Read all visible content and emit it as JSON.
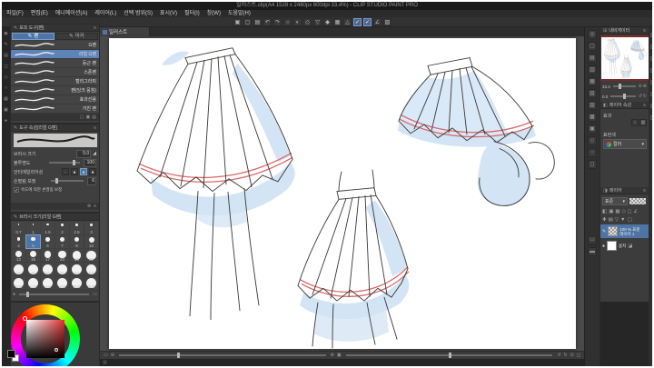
{
  "window": {
    "title": "일러스트.clip(A4 1528 x 2480px 600dpi 33.4%) - CLIP STUDIO PAINT PRO"
  },
  "menu": {
    "items": [
      "파일(F)",
      "편집(E)",
      "애니메이션(A)",
      "레이어(L)",
      "선택 범위(S)",
      "표시(V)",
      "필터(I)",
      "창(W)",
      "도움말(H)"
    ]
  },
  "toolbar": {
    "icons": [
      {
        "name": "save-icon",
        "glyph": "▣",
        "active": false
      },
      {
        "name": "open-icon",
        "glyph": "▢",
        "active": false
      },
      {
        "name": "export-icon",
        "glyph": "▤",
        "active": false
      },
      {
        "name": "undo-icon",
        "glyph": "↶",
        "active": false
      },
      {
        "name": "redo-icon",
        "glyph": "↷",
        "active": false
      },
      {
        "name": "deselect-icon",
        "glyph": "○",
        "active": false
      },
      {
        "name": "invert-selection-icon",
        "glyph": "◐",
        "active": false
      },
      {
        "name": "selection-border-icon",
        "glyph": "◇",
        "active": false
      },
      {
        "name": "clear-icon",
        "glyph": "▽",
        "active": false
      },
      {
        "name": "fill-icon",
        "glyph": "◆",
        "active": false
      },
      {
        "name": "grid-icon",
        "glyph": "▦",
        "active": false
      },
      {
        "name": "snap-ruler-icon",
        "glyph": "△",
        "active": false
      },
      {
        "name": "snap-line-icon",
        "glyph": "✓",
        "active": true
      },
      {
        "name": "snap-special-ruler-icon",
        "glyph": "✓",
        "active": true
      },
      {
        "name": "ruler-icon",
        "glyph": "∠",
        "active": false
      },
      {
        "name": "toolbar-settings-icon",
        "glyph": "▧",
        "active": false
      }
    ]
  },
  "left_tools": {
    "icons": [
      {
        "name": "tool-icon",
        "glyph": "◉"
      },
      {
        "name": "tool-icon",
        "glyph": "✎"
      },
      {
        "name": "tool-icon",
        "glyph": "▤"
      },
      {
        "name": "tool-icon",
        "glyph": "◻"
      },
      {
        "name": "tool-icon",
        "glyph": "◇"
      },
      {
        "name": "tool-icon",
        "glyph": "○"
      },
      {
        "name": "tool-icon",
        "glyph": "▦"
      },
      {
        "name": "tool-icon",
        "glyph": "▣"
      },
      {
        "name": "tool-icon",
        "glyph": "●"
      }
    ]
  },
  "subtool_panel": {
    "title": "보조 도구[펜]",
    "tabs": [
      {
        "label": "펜",
        "active": true
      },
      {
        "label": "마커",
        "active": false
      }
    ],
    "brushes": [
      {
        "label": "G펜"
      },
      {
        "label": "리얼 G펜",
        "selected": true
      },
      {
        "label": "둥근 펜"
      },
      {
        "label": "스푼펜"
      },
      {
        "label": "캘리그라피"
      },
      {
        "label": "펜(잉크 뭉침)"
      },
      {
        "label": "효과선용"
      },
      {
        "label": "거친 펜"
      }
    ]
  },
  "tool_property": {
    "title": "도구 속성[리얼 G펜]",
    "brush_size_label": "브러시 크기",
    "brush_size_value": "5.0",
    "opacity_label": "불투명도",
    "opacity_value": "100",
    "antialias_label": "안티에일리어싱",
    "stabilize_label": "손떨림 보정",
    "stabilize_value": "6",
    "speed_stabilize_label": "속도에 의한 손떨림 보정"
  },
  "brush_size_panel": {
    "title": "브러시 크기[리얼 G펜]",
    "selected": "5",
    "sizes": [
      "0.7",
      "1",
      "1.5",
      "2",
      "2.5",
      "3",
      "4",
      "5",
      "6",
      "7",
      "8",
      "10",
      "12",
      "15",
      "17",
      "20",
      "25",
      "30",
      "35",
      "40",
      "50",
      "60",
      "70",
      "80",
      "100",
      "120",
      "150",
      "200",
      "250",
      "300"
    ]
  },
  "canvas": {
    "tab_label": "일러스트"
  },
  "navigator": {
    "title": "내비게이터",
    "zoom_value": "33.4",
    "rotate_value": "0.0"
  },
  "layer_property": {
    "title": "레이어 속성",
    "effect_label": "효과",
    "expression_label": "표현색",
    "expression_value": "컬러"
  },
  "layer_panel": {
    "title": "레이어",
    "blend_mode": "표준",
    "layers": [
      {
        "info": "100 % 표준",
        "name": "레이어 1",
        "selected": true
      },
      {
        "info": "",
        "name": "용지",
        "selected": false
      }
    ]
  },
  "colors": {
    "selection_blue": "#5d84b8",
    "accent_red": "#d96868",
    "shade_blue": "#cfe2f4"
  }
}
